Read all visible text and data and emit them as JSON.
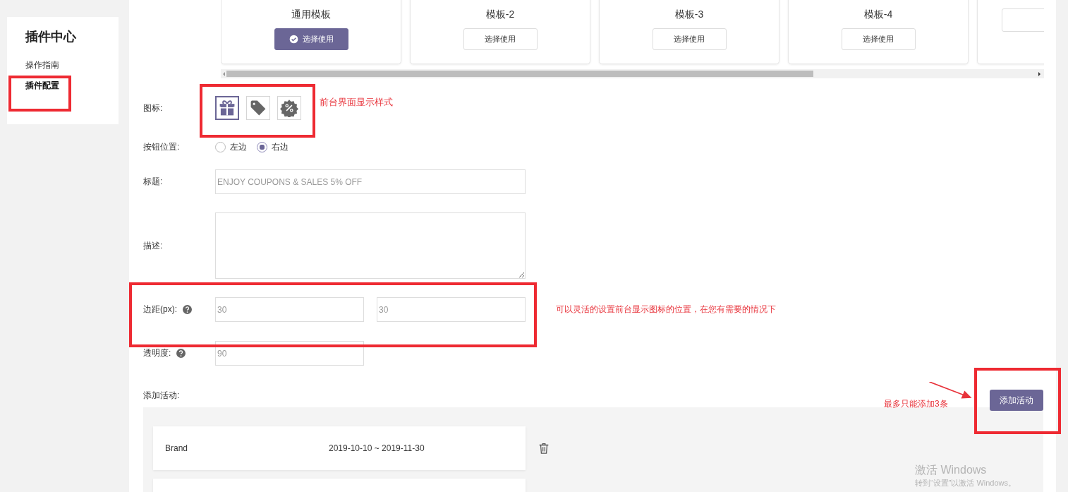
{
  "sidebar": {
    "title": "插件中心",
    "items": [
      {
        "label": "操作指南",
        "selected": false
      },
      {
        "label": "插件配置",
        "selected": true
      }
    ]
  },
  "templates": [
    {
      "name": "通用模板",
      "button": "选择使用",
      "selected": true
    },
    {
      "name": "模板-2",
      "button": "选择使用",
      "selected": false
    },
    {
      "name": "模板-3",
      "button": "选择使用",
      "selected": false
    },
    {
      "name": "模板-4",
      "button": "选择使用",
      "selected": false
    }
  ],
  "form": {
    "icon": {
      "label": "图标:",
      "options": [
        {
          "kind": "gift",
          "selected": true
        },
        {
          "kind": "tag",
          "selected": false
        },
        {
          "kind": "badge",
          "selected": false
        }
      ]
    },
    "button_position": {
      "label": "按钮位置:",
      "options": [
        {
          "label": "左边",
          "selected": false
        },
        {
          "label": "右边",
          "selected": true
        }
      ]
    },
    "title": {
      "label": "标题:",
      "placeholder": "ENJOY COUPONS & SALES 5% OFF"
    },
    "description": {
      "label": "描述:"
    },
    "margin": {
      "label": "边距(px):",
      "fields": [
        {
          "placeholder": "30"
        },
        {
          "placeholder": "30"
        }
      ]
    },
    "opacity": {
      "label": "透明度:",
      "placeholder": "90"
    },
    "activities": {
      "label": "添加活动:",
      "button": "添加活动",
      "items": [
        {
          "name": "Brand",
          "dates": "2019-10-10 ~ 2019-11-30"
        }
      ]
    }
  },
  "annotations": [
    "前台界面显示样式",
    "可以灵活的设置前台显示图标的位置，在您有需要的情况下",
    "最多只能添加3条"
  ],
  "windows_notice": {
    "title": "激活 Windows",
    "subtitle": "转到“设置”以激活 Windows。"
  }
}
